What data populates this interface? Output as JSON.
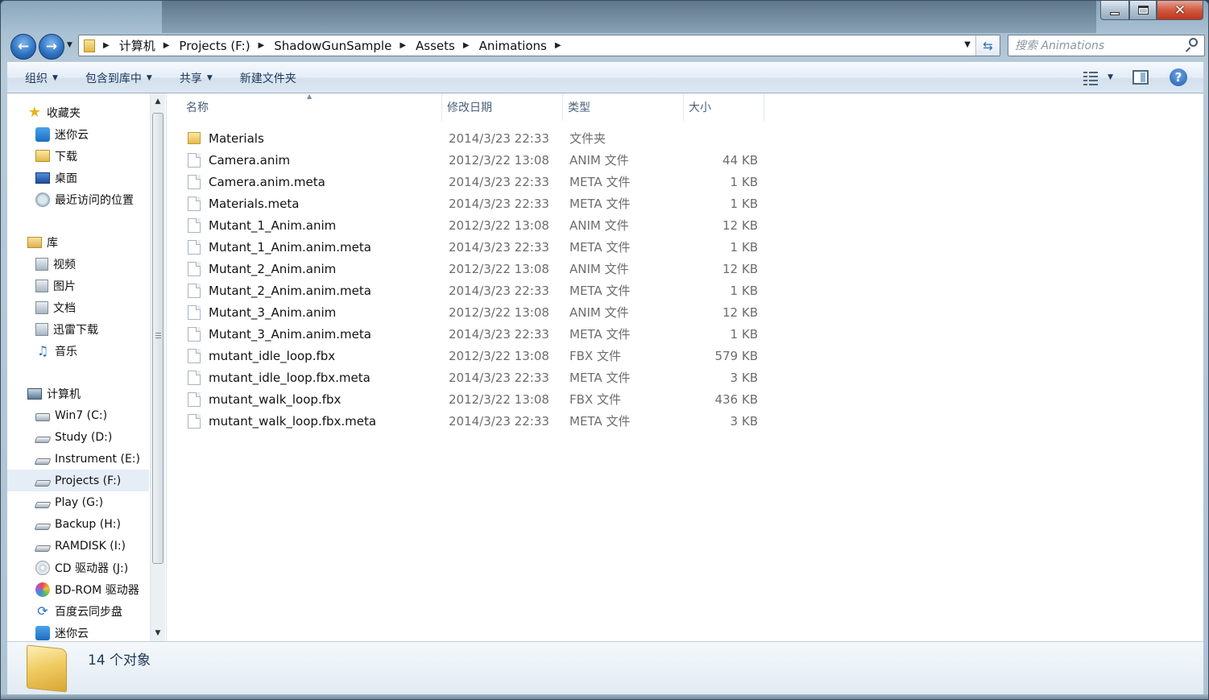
{
  "window": {
    "breadcrumbs": [
      "计算机",
      "Projects (F:)",
      "ShadowGunSample",
      "Assets",
      "Animations"
    ],
    "search_placeholder": "搜索 Animations"
  },
  "command_bar": {
    "organize": "组织",
    "include_in_library": "包含到库中",
    "share": "共享",
    "new_folder": "新建文件夹"
  },
  "nav": {
    "favorites": {
      "label": "收藏夹",
      "items": [
        {
          "label": "迷你云",
          "icon": "cloud-icon"
        },
        {
          "label": "下载",
          "icon": "folder-icon"
        },
        {
          "label": "桌面",
          "icon": "desktop-icon"
        },
        {
          "label": "最近访问的位置",
          "icon": "recent-places-icon"
        }
      ]
    },
    "libraries": {
      "label": "库",
      "items": [
        {
          "label": "视频",
          "icon": "video-library-icon"
        },
        {
          "label": "图片",
          "icon": "pictures-library-icon"
        },
        {
          "label": "文档",
          "icon": "documents-library-icon"
        },
        {
          "label": "迅雷下载",
          "icon": "library-folder-icon"
        },
        {
          "label": "音乐",
          "icon": "music-library-icon"
        }
      ]
    },
    "computer": {
      "label": "计算机",
      "items": [
        {
          "label": "Win7 (C:)",
          "icon": "windows-drive-icon"
        },
        {
          "label": "Study (D:)",
          "icon": "drive-icon"
        },
        {
          "label": "Instrument (E:)",
          "icon": "drive-icon"
        },
        {
          "label": "Projects (F:)",
          "icon": "drive-icon",
          "selected": true
        },
        {
          "label": "Play (G:)",
          "icon": "drive-icon"
        },
        {
          "label": "Backup (H:)",
          "icon": "drive-icon"
        },
        {
          "label": "RAMDISK (I:)",
          "icon": "drive-icon"
        },
        {
          "label": "CD 驱动器 (J:)",
          "icon": "cd-drive-icon"
        },
        {
          "label": "BD-ROM 驱动器",
          "icon": "bd-rom-drive-icon"
        },
        {
          "label": "百度云同步盘",
          "icon": "sync-drive-icon"
        },
        {
          "label": "迷你云",
          "icon": "cloud-icon"
        }
      ]
    }
  },
  "columns": {
    "name": "名称",
    "date": "修改日期",
    "type": "类型",
    "size": "大小"
  },
  "files": [
    {
      "name": "Materials",
      "date": "2014/3/23 22:33",
      "type": "文件夹",
      "size": "",
      "kind": "folder"
    },
    {
      "name": "Camera.anim",
      "date": "2012/3/22 13:08",
      "type": "ANIM 文件",
      "size": "44 KB",
      "kind": "file"
    },
    {
      "name": "Camera.anim.meta",
      "date": "2014/3/23 22:33",
      "type": "META 文件",
      "size": "1 KB",
      "kind": "file"
    },
    {
      "name": "Materials.meta",
      "date": "2014/3/23 22:33",
      "type": "META 文件",
      "size": "1 KB",
      "kind": "file"
    },
    {
      "name": "Mutant_1_Anim.anim",
      "date": "2012/3/22 13:08",
      "type": "ANIM 文件",
      "size": "12 KB",
      "kind": "file"
    },
    {
      "name": "Mutant_1_Anim.anim.meta",
      "date": "2014/3/23 22:33",
      "type": "META 文件",
      "size": "1 KB",
      "kind": "file"
    },
    {
      "name": "Mutant_2_Anim.anim",
      "date": "2012/3/22 13:08",
      "type": "ANIM 文件",
      "size": "12 KB",
      "kind": "file"
    },
    {
      "name": "Mutant_2_Anim.anim.meta",
      "date": "2014/3/23 22:33",
      "type": "META 文件",
      "size": "1 KB",
      "kind": "file"
    },
    {
      "name": "Mutant_3_Anim.anim",
      "date": "2012/3/22 13:08",
      "type": "ANIM 文件",
      "size": "12 KB",
      "kind": "file"
    },
    {
      "name": "Mutant_3_Anim.anim.meta",
      "date": "2014/3/23 22:33",
      "type": "META 文件",
      "size": "1 KB",
      "kind": "file"
    },
    {
      "name": "mutant_idle_loop.fbx",
      "date": "2012/3/22 13:08",
      "type": "FBX 文件",
      "size": "579 KB",
      "kind": "file"
    },
    {
      "name": "mutant_idle_loop.fbx.meta",
      "date": "2014/3/23 22:33",
      "type": "META 文件",
      "size": "3 KB",
      "kind": "file"
    },
    {
      "name": "mutant_walk_loop.fbx",
      "date": "2012/3/22 13:08",
      "type": "FBX 文件",
      "size": "436 KB",
      "kind": "file"
    },
    {
      "name": "mutant_walk_loop.fbx.meta",
      "date": "2014/3/23 22:33",
      "type": "META 文件",
      "size": "3 KB",
      "kind": "file"
    }
  ],
  "details": {
    "item_count": "14 个对象"
  }
}
